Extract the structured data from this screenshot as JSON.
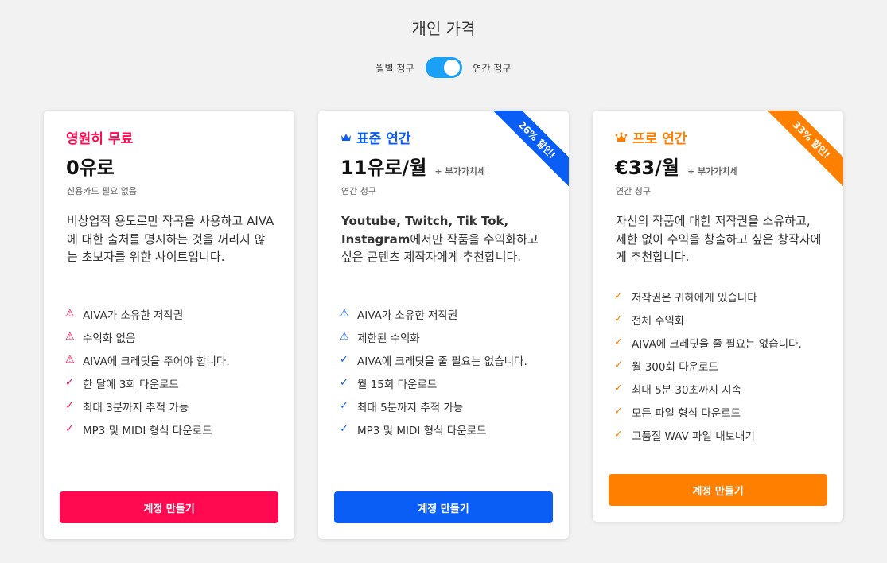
{
  "page": {
    "title": "개인 가격",
    "billing": {
      "monthly_label": "월별 청구",
      "annual_label": "연간 청구",
      "annual_selected": true
    }
  },
  "colors": {
    "free": "#ff0a50",
    "standard": "#0a5ef5",
    "pro": "#ff7f00",
    "toggle": "#1aa0f5"
  },
  "plans": [
    {
      "name": "영원히 무료",
      "price": "0유로",
      "vat": "",
      "sub_note": "신용카드 필요 없음",
      "description": "비상업적 용도로만 작곡을 사용하고 AIVA에 대한 출처를 명시하는 것을 꺼리지 않는 초보자를 위한 사이트입니다.",
      "features": [
        {
          "icon": "warning-icon",
          "text": "AIVA가 소유한 저작권"
        },
        {
          "icon": "warning-icon",
          "text": "수익화 없음"
        },
        {
          "icon": "warning-icon",
          "text": "AIVA에 크레딧을 주어야 합니다."
        },
        {
          "icon": "check-icon",
          "text": "한 달에 3회 다운로드"
        },
        {
          "icon": "check-icon",
          "text": "최대 3분까지 추적 가능"
        },
        {
          "icon": "check-icon",
          "text": "MP3 및 MIDI 형식 다운로드"
        }
      ],
      "cta": "계정 만들기"
    },
    {
      "name": "표준 연간",
      "icon": "crown-icon",
      "price": "11유로/월",
      "vat": "+ 부가가치세",
      "sub_note": "연간 청구",
      "ribbon": "26% 할인!",
      "description_bold": "Youtube, Twitch, Tik Tok, Instagram",
      "description": "에서만 작품을 수익화하고 싶은 콘텐츠 제작자에게 추천합니다.",
      "features": [
        {
          "icon": "warning-icon",
          "text": "AIVA가 소유한 저작권"
        },
        {
          "icon": "warning-icon",
          "text": "제한된 수익화"
        },
        {
          "icon": "check-icon",
          "text": "AIVA에 크레딧을 줄 필요는 없습니다."
        },
        {
          "icon": "check-icon",
          "text": "월 15회 다운로드"
        },
        {
          "icon": "check-icon",
          "text": "최대 5분까지 추적 가능"
        },
        {
          "icon": "check-icon",
          "text": "MP3 및 MIDI 형식 다운로드"
        }
      ],
      "cta": "계정 만들기"
    },
    {
      "name": "프로 연간",
      "icon": "crown-icon",
      "price": "€33/월",
      "vat": "+ 부가가치세",
      "sub_note": "연간 청구",
      "ribbon": "33% 할인!",
      "description": "자신의 작품에 대한 저작권을 소유하고, 제한 없이 수익을 창출하고 싶은 창작자에게 추천합니다.",
      "features": [
        {
          "icon": "check-icon",
          "text": "저작권은 귀하에게 있습니다"
        },
        {
          "icon": "check-icon",
          "text": "전체 수익화"
        },
        {
          "icon": "check-icon",
          "text": "AIVA에 크레딧을 줄 필요는 없습니다."
        },
        {
          "icon": "check-icon",
          "text": "월 300회 다운로드"
        },
        {
          "icon": "check-icon",
          "text": "최대 5분 30초까지 지속"
        },
        {
          "icon": "check-icon",
          "text": "모든 파일 형식 다운로드"
        },
        {
          "icon": "check-icon",
          "text": "고품질 WAV 파일 내보내기"
        }
      ],
      "cta": "계정 만들기"
    }
  ]
}
